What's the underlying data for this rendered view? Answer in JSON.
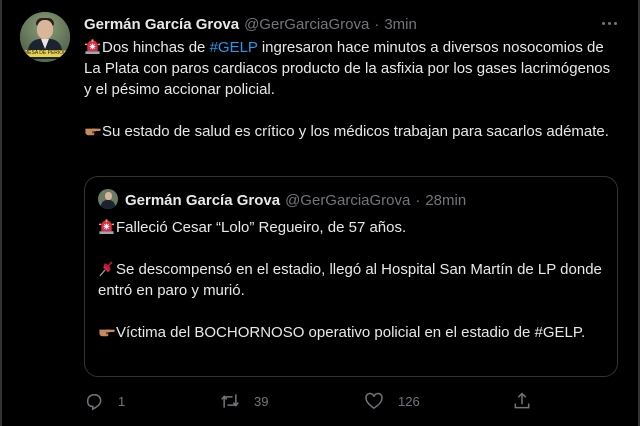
{
  "tweet": {
    "author_name": "Germán García Grova",
    "author_handle": "@GerGarciaGrova",
    "separator": "·",
    "time": "3min",
    "avatar_banner": "MESA DE PERIODISTAS",
    "text": {
      "p1_a": "Dos hinchas de ",
      "p1_hashtag": "#GELP",
      "p1_b": " ingresaron hace minutos a diversos nosocomios de La Plata con paros cardiacos producto de la asfixia por los gases lacrimógenos y el pésimo accionar policial.",
      "p2": "Su estado de salud es crítico y los médicos trabajan para sacarlos adémate."
    }
  },
  "quoted": {
    "author_name": "Germán García Grova",
    "author_handle": "@GerGarciaGrova",
    "separator": "·",
    "time": "28min",
    "line1": "Falleció Cesar “Lolo” Regueiro, de 57 años.",
    "line2": "Se descompensó en el estadio, llegó al Hospital San Martín de LP donde entró en paro y murió.",
    "line3": "Víctima del BOCHORNOSO operativo policial en el estadio de #GELP."
  },
  "actions": {
    "replies": "1",
    "retweets": "39",
    "likes": "126"
  },
  "icons": {
    "siren": "siren-emoji-icon",
    "pointing": "backhand-index-pointing-right-icon",
    "pushpin": "pushpin-emoji-icon",
    "reply": "reply-icon",
    "retweet": "retweet-icon",
    "like": "heart-icon",
    "share": "share-icon",
    "more": "more-icon"
  },
  "colors": {
    "background": "#000000",
    "text": "#e7e9ea",
    "muted": "#71767b",
    "link": "#1d9bf0",
    "border": "#2f3336"
  }
}
